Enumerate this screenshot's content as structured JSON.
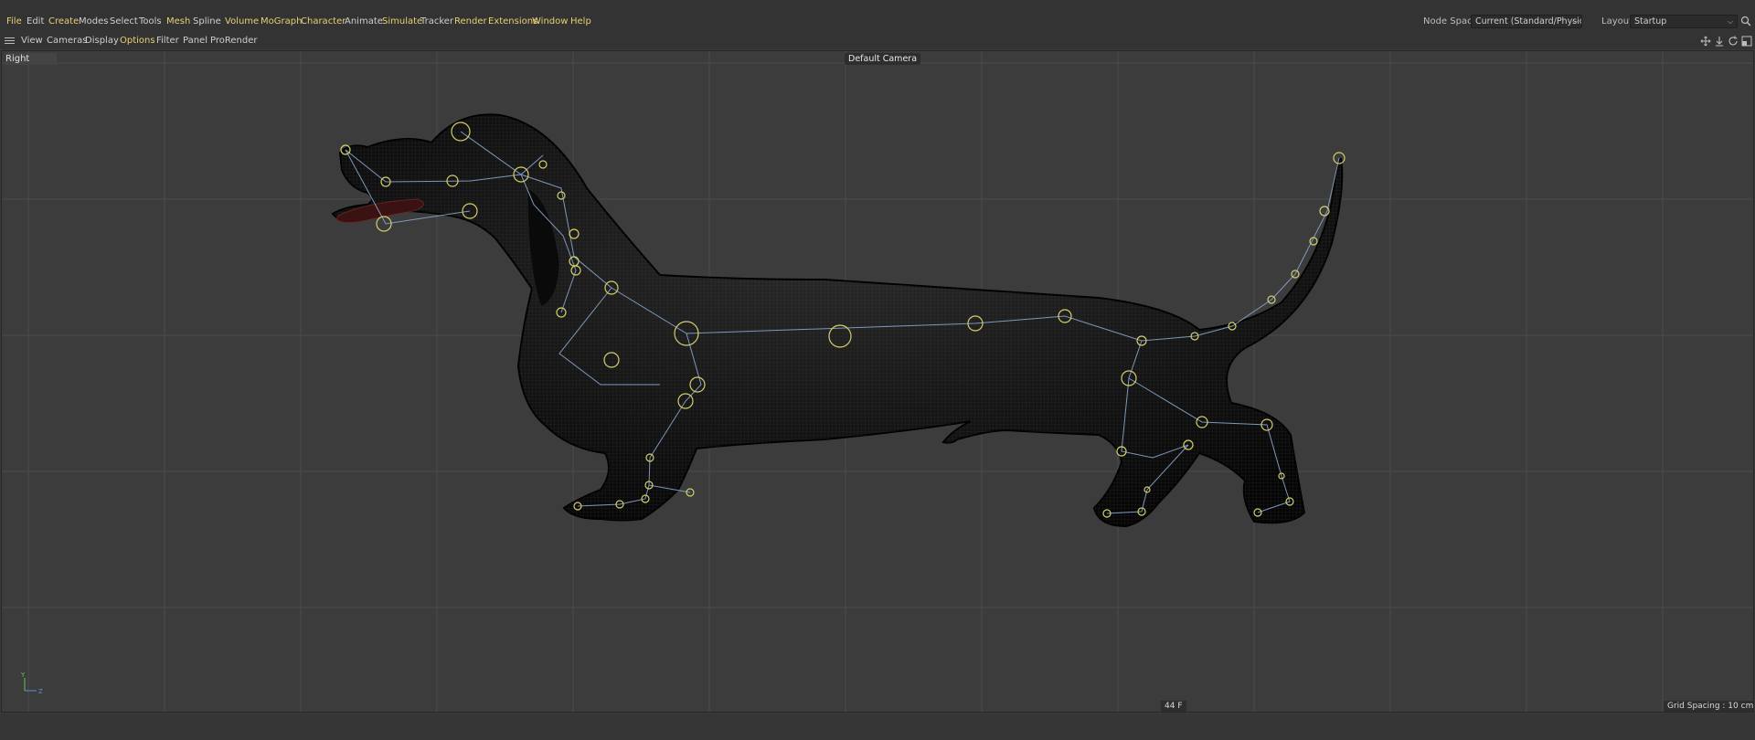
{
  "menubar": {
    "items": [
      {
        "label": "File",
        "accent": true
      },
      {
        "label": "Edit",
        "accent": false
      },
      {
        "label": "Create",
        "accent": true
      },
      {
        "label": "Modes",
        "accent": false
      },
      {
        "label": "Select",
        "accent": false
      },
      {
        "label": "Tools",
        "accent": false
      },
      {
        "label": "Mesh",
        "accent": true
      },
      {
        "label": "Spline",
        "accent": false
      },
      {
        "label": "Volume",
        "accent": true
      },
      {
        "label": "MoGraph",
        "accent": true
      },
      {
        "label": "Character",
        "accent": true
      },
      {
        "label": "Animate",
        "accent": false
      },
      {
        "label": "Simulate",
        "accent": true
      },
      {
        "label": "Tracker",
        "accent": false
      },
      {
        "label": "Render",
        "accent": true
      },
      {
        "label": "Extensions",
        "accent": true
      },
      {
        "label": "Window",
        "accent": true
      },
      {
        "label": "Help",
        "accent": true
      }
    ],
    "node_space_label": "Node Space:",
    "node_space_value": "Current (Standard/Physical)",
    "layout_label": "Layout:",
    "layout_value": "Startup",
    "search_icon": "search-icon"
  },
  "viewport_menu": {
    "items": [
      {
        "label": "View",
        "accent": false
      },
      {
        "label": "Cameras",
        "accent": false
      },
      {
        "label": "Display",
        "accent": false
      },
      {
        "label": "Options",
        "accent": true
      },
      {
        "label": "Filter",
        "accent": false
      },
      {
        "label": "Panel",
        "accent": false
      },
      {
        "label": "ProRender",
        "accent": false
      }
    ],
    "controls": [
      "move-view-icon",
      "zoom-view-icon",
      "rotate-view-icon",
      "toggle-panel-icon"
    ]
  },
  "viewport": {
    "view_name": "Right",
    "camera": "Default Camera",
    "frame": "44 F",
    "grid_spacing": "Grid Spacing : 10 cm",
    "axis": {
      "y": "Y",
      "z": "Z"
    }
  },
  "colors": {
    "accent": "#e6cf74",
    "menu_text": "#cfcfcf",
    "background": "#333333",
    "viewport": "#3c3c3c",
    "grid": "#4a4a4a",
    "joint": "#d4cf6a",
    "bone": "#8aa6cc"
  }
}
